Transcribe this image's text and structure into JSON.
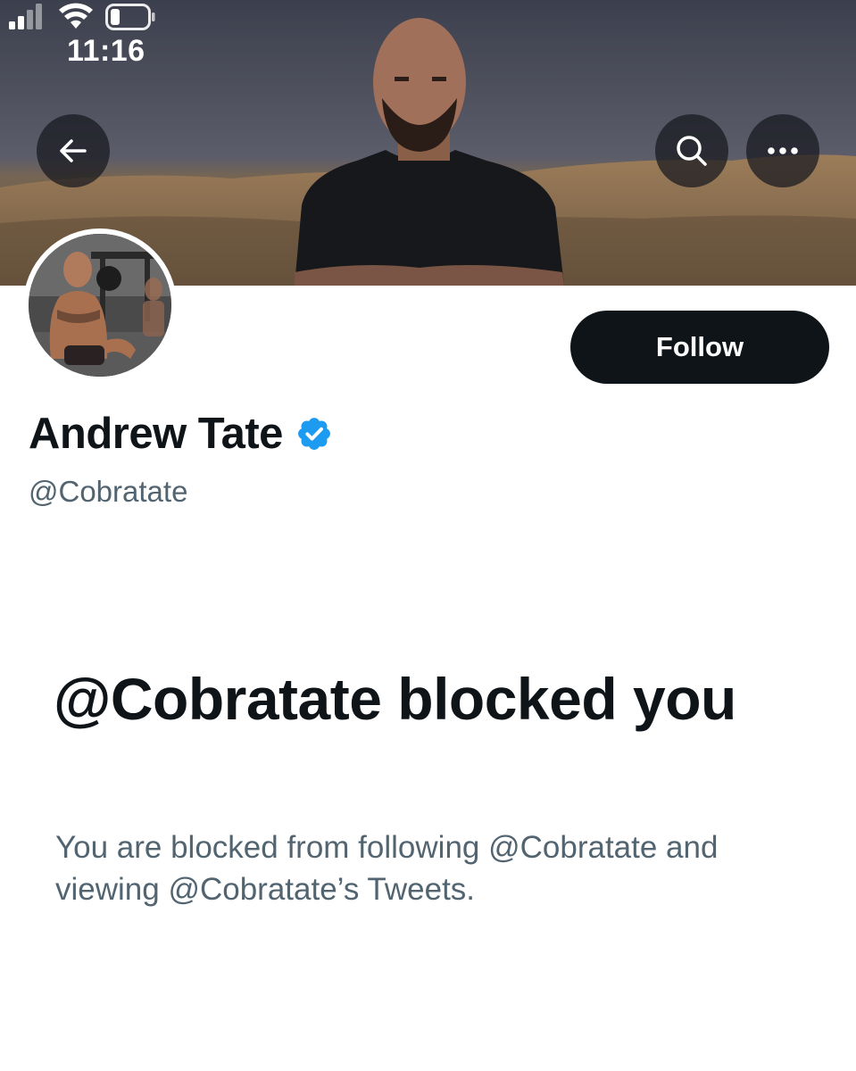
{
  "status_bar": {
    "time": "11:16",
    "signal_icon": "cellular-signal-icon",
    "wifi_icon": "wifi-icon",
    "battery_icon": "battery-icon"
  },
  "header": {
    "back_icon": "arrow-left-icon",
    "search_icon": "search-icon",
    "more_icon": "ellipsis-icon"
  },
  "profile": {
    "display_name": "Andrew Tate",
    "handle": "@Cobratate",
    "verified_icon": "verified-badge-icon",
    "verified_color": "#1d9bf0",
    "follow_label": "Follow"
  },
  "blocked": {
    "title": "@Cobratate blocked you",
    "description": "You are blocked from following @Cobratate and viewing @Cobratate’s Tweets."
  },
  "colors": {
    "primary_text": "#0f1419",
    "secondary_text": "#536471",
    "button_bg": "#0f1419",
    "background": "#ffffff"
  }
}
